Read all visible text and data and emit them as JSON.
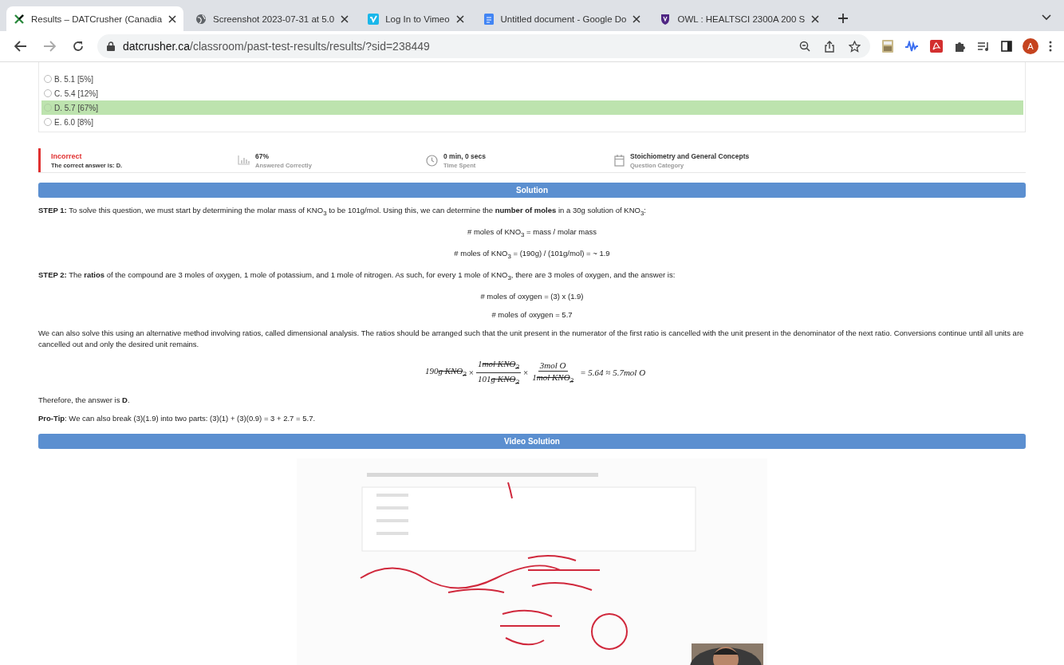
{
  "browser": {
    "tabs": [
      {
        "title": "Results – DATCrusher (Canadia",
        "kind": "x",
        "selected": true
      },
      {
        "title": "Screenshot 2023-07-31 at 5.0",
        "kind": "globe",
        "selected": false
      },
      {
        "title": "Log In to Vimeo",
        "kind": "vimeo",
        "selected": false
      },
      {
        "title": "Untitled document - Google Do",
        "kind": "doc",
        "selected": false
      },
      {
        "title": "OWL : HEALTSCI 2300A 200 S",
        "kind": "shield",
        "selected": false
      }
    ],
    "url_host": "datcrusher.ca",
    "url_path": "/classroom/past-test-results/results/?sid=238449",
    "profile": "A"
  },
  "options": [
    {
      "label": "B. 5.1 [5%]",
      "correct": false
    },
    {
      "label": "C. 5.4 [12%]",
      "correct": false
    },
    {
      "label": "D. 5.7 [67%]",
      "correct": true
    },
    {
      "label": "E. 6.0 [8%]",
      "correct": false
    }
  ],
  "result": {
    "status": "Incorrect",
    "detail": "The correct answer is: D.",
    "stats": [
      {
        "kind": "chart",
        "value": "67%",
        "label": "Answered Correctly"
      },
      {
        "kind": "clock",
        "value": "0 min, 0 secs",
        "label": "Time Spent"
      },
      {
        "kind": "calendar",
        "value": "Stoichiometry and General Concepts",
        "label": "Question Category"
      }
    ]
  },
  "solution": {
    "heading": "Solution",
    "blocks": [
      {
        "kind": "para",
        "text": "**STEP 1:** To solve this question, we must start by determining the molar mass of KNO$_{3}$ to be 101g/mol. Using this, we can determine the **number of moles** in a 30g solution of KNO$_{3}$:"
      },
      {
        "kind": "equation",
        "text": "# moles of KNO$_{3}$ = mass / molar mass"
      },
      {
        "kind": "equation",
        "text": "# moles of KNO$_{3}$ = (190g) / (101g/mol) = ~ 1.9"
      },
      {
        "kind": "para",
        "text": "**STEP 2:** The **ratios** of the compound are 3 moles of oxygen, 1 mole of potassium, and 1 mole of nitrogen. As such, for every 1 mole of KNO$_{3}$, there are 3 moles of oxygen, and the answer is:"
      },
      {
        "kind": "equation",
        "text": "# moles of oxygen = (3) x (1.9)"
      },
      {
        "kind": "equation",
        "text": "# moles of oxygen = 5.7"
      },
      {
        "kind": "para",
        "text": "We can also solve this using an alternative method involving ratios, called dimensional analysis. The ratios should be arranged such that the unit present in the numerator of the first ratio is cancelled with the unit present in the denominator of the next ratio. Conversions continue until all units are cancelled out and only the desired unit remains."
      },
      {
        "kind": "formula",
        "lead": {
          "value": "190",
          "struck": "g KNO$_{3}$"
        },
        "fractions": [
          {
            "num": {
              "value": "1",
              "struck": "mol KNO$_{3}$"
            },
            "den": {
              "value": "101",
              "struck": "g KNO$_{3}$"
            }
          },
          {
            "num": {
              "value": "3mol O"
            },
            "den": {
              "value": "1",
              "struck": "mol KNO$_{3}$"
            }
          }
        ],
        "times": "×",
        "result": "= 5.64 ≈ 5.7mol O"
      },
      {
        "kind": "para",
        "text": "Therefore, the answer is **D**."
      },
      {
        "kind": "para",
        "text": "**Pro-Tip**: We can also break (3)(1.9) into two parts: (3)(1) + (3)(0.9) =  3 + 2.7 = 5.7."
      }
    ]
  },
  "video": {
    "heading": "Video Solution",
    "kind": "picture"
  }
}
